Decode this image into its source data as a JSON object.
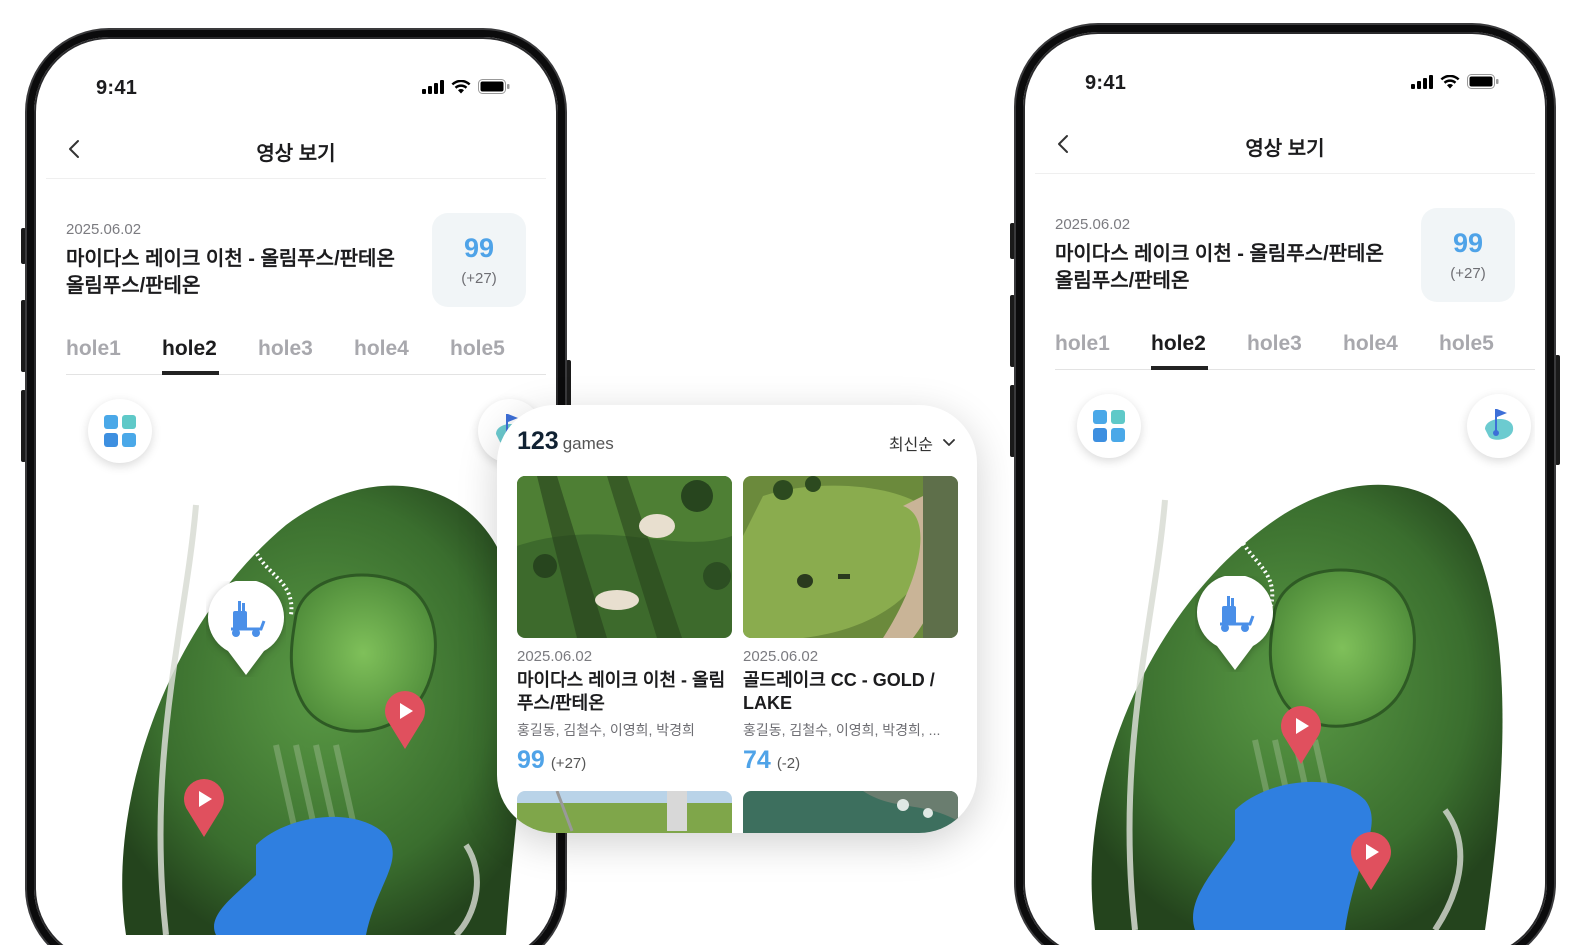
{
  "phone": {
    "status_time": "9:41",
    "nav_title": "영상 보기",
    "round": {
      "date": "2025.06.02",
      "title": "마이다스 레이크 이천 - 올림푸스/판테온 올림푸스/판테온",
      "score": "99",
      "score_diff": "(+27)"
    },
    "holes": [
      "hole1",
      "hole2",
      "hole3",
      "hole4",
      "hole5"
    ],
    "active_hole": "hole2"
  },
  "games_panel": {
    "count": "123",
    "count_unit": "games",
    "sort_label": "최신순",
    "games": [
      {
        "date": "2025.06.02",
        "title": "마이다스 레이크 이천 - 올림푸스/판테온",
        "players": "홍길동, 김철수, 이영희, 박경희",
        "score": "99",
        "diff": "(+27)"
      },
      {
        "date": "2025.06.02",
        "title": "골드레이크 CC - GOLD / LAKE",
        "players": "홍길동, 김철수, 이영희, 박경희, ...",
        "score": "74",
        "diff": "(-2)"
      }
    ]
  },
  "colors": {
    "accent_blue": "#4fa3e8",
    "marker_red": "#e0505e",
    "fairway_green": "#3f7a35",
    "water_blue": "#2f7fe0"
  }
}
